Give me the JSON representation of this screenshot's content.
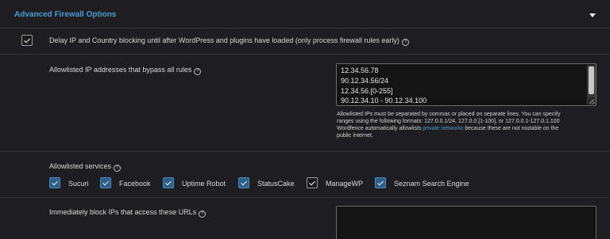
{
  "header": {
    "title": "Advanced Firewall Options"
  },
  "delay_option": {
    "label": "Delay IP and Country blocking until after WordPress and plugins have loaded (only process firewall rules early)",
    "checked": true
  },
  "allowlisted_ips": {
    "label": "Allowlisted IP addresses that bypass all rules",
    "lines": [
      "12.34.56.78",
      "90.12.34.56/24",
      "12.34.56.[0-255]",
      "90.12.34.10 - 90.12.34.100"
    ],
    "help_line1": "Allowlisted IPs must be separated by commas or placed on separate lines. You can specify",
    "help_line2": "ranges using the following formats: 127.0.0.1/24, 127.0.0.[1-100], or 127.0.0.1-127.0.1.100",
    "help_line3_pre": "Wordfence automatically allowlists ",
    "help_link": "private networks",
    "help_line3_post": " because these are not routable on the",
    "help_line4": "public Internet."
  },
  "allowlisted_services": {
    "label": "Allowlisted services",
    "items": [
      {
        "label": "Sucuri",
        "checked": true
      },
      {
        "label": "Facebook",
        "checked": true
      },
      {
        "label": "Uptime Robot",
        "checked": true
      },
      {
        "label": "StatusCake",
        "checked": true
      },
      {
        "label": "ManageWP",
        "checked": true
      },
      {
        "label": "Seznam Search Engine",
        "checked": true
      }
    ]
  },
  "block_urls": {
    "label": "Immediately block IPs that access these URLs"
  },
  "colors": {
    "accent": "#4a9ad4",
    "checkbox_blue": "#2d5f8a",
    "background": "#1e1e20"
  },
  "icons": {
    "help": "?",
    "caret": "caret-down-icon"
  }
}
